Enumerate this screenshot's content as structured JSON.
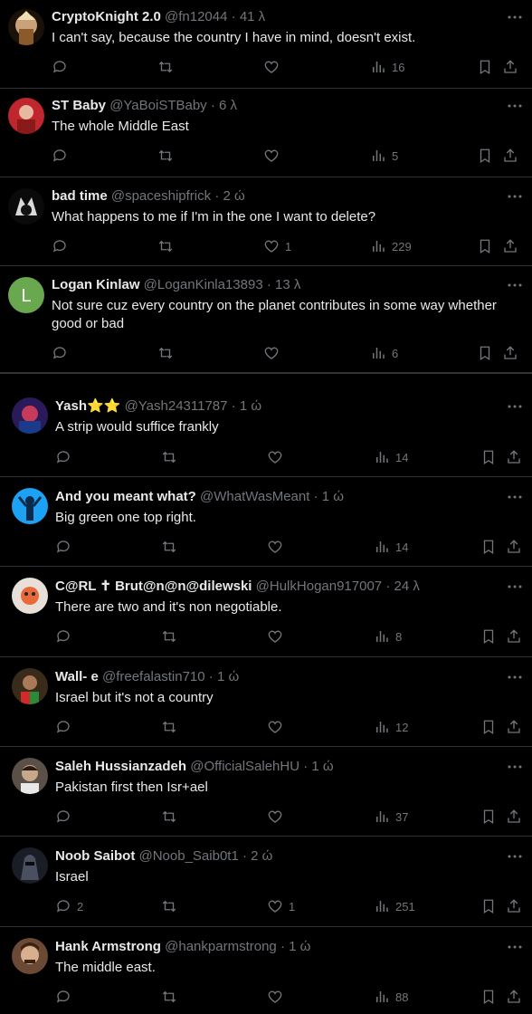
{
  "tweets": [
    {
      "name": "CryptoKnight 2.0",
      "handle": "@fn12044",
      "time": "41 λ",
      "text": "I can't say, because the country I have in mind, doesn't exist.",
      "replies": "",
      "likes": "",
      "views": "16",
      "avatar_color": "#c9a27a"
    },
    {
      "name": "ST Baby",
      "handle": "@YaBoiSTBaby",
      "time": "6 λ",
      "text": "The whole Middle East",
      "replies": "",
      "likes": "",
      "views": "5",
      "avatar_color": "#c0262d"
    },
    {
      "name": "bad time",
      "handle": "@spaceshipfrick",
      "time": "2 ώ",
      "text": "What happens to me if I'm in the one I want to delete?",
      "replies": "",
      "likes": "1",
      "views": "229",
      "avatar_color": "#222222"
    },
    {
      "name": "Logan Kinlaw",
      "handle": "@LoganKinla13893",
      "time": "13 λ",
      "text": "Not sure cuz every country on the planet contributes in some way whether good or bad",
      "replies": "",
      "likes": "",
      "views": "6",
      "avatar_color": "#6aa84f",
      "avatar_letter": "L"
    },
    {
      "name": "Yash",
      "name_suffix": "⭐⭐",
      "handle": "@Yash24311787",
      "time": "1 ώ",
      "text": "A strip would suffice frankly",
      "replies": "",
      "likes": "",
      "views": "14",
      "avatar_color": "#3b2a7a"
    },
    {
      "name": "And you meant what?",
      "handle": "@WhatWasMeant",
      "time": "1 ώ",
      "text": "Big green one top right.",
      "replies": "",
      "likes": "",
      "views": "14",
      "avatar_color": "#1da1f2"
    },
    {
      "name": "C@RL ✝ Brut@n@n@dilewski",
      "handle": "@HulkHogan917007",
      "time": "24 λ",
      "text": "There are two and it's non negotiable.",
      "replies": "",
      "likes": "",
      "views": "8",
      "avatar_color": "#e8e0d8"
    },
    {
      "name": "Wall- e",
      "handle": "@freefalastin710",
      "time": "1 ώ",
      "text": "Israel but it's not a country",
      "replies": "",
      "likes": "",
      "views": "12",
      "avatar_color": "#3a2a1a"
    },
    {
      "name": "Saleh Hussianzadeh",
      "handle": "@OfficialSalehHU",
      "time": "1 ώ",
      "text": "Pakistan first then Isr+ael",
      "replies": "",
      "likes": "",
      "views": "37",
      "avatar_color": "#8a7a6a"
    },
    {
      "name": "Noob Saibot",
      "handle": "@Noob_Saib0t1",
      "time": "2 ώ",
      "text": "Israel",
      "replies": "2",
      "likes": "1",
      "views": "251",
      "avatar_color": "#2a2d35"
    },
    {
      "name": "Hank Armstrong",
      "handle": "@hankparmstrong",
      "time": "1 ώ",
      "text": "The middle east.",
      "replies": "",
      "likes": "",
      "views": "88",
      "avatar_color": "#6b4a35"
    }
  ],
  "separator": "·"
}
